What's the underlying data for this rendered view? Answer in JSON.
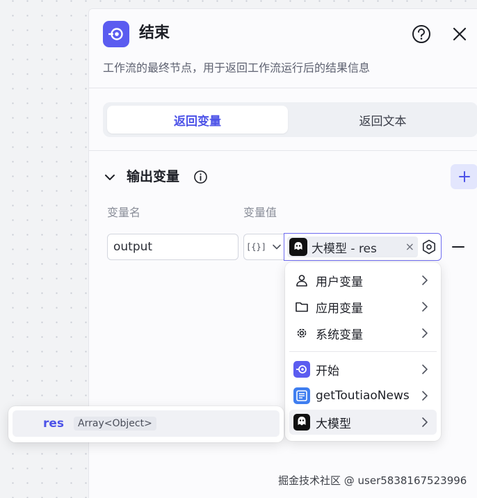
{
  "header": {
    "title": "结束",
    "description": "工作流的最终节点，用于返回工作流运行后的结果信息",
    "accent_color": "#5b5cf0"
  },
  "mode_tabs": [
    {
      "label": "返回变量",
      "active": true
    },
    {
      "label": "返回文本",
      "active": false
    }
  ],
  "output_section": {
    "title": "输出变量",
    "columns": {
      "name": "变量名",
      "value": "变量值"
    },
    "row": {
      "name_value": "output",
      "type_icon": "braces-icon",
      "reference_label": "大模型 - res"
    }
  },
  "dropdown": {
    "items": [
      {
        "label": "用户变量",
        "icon": "user-icon"
      },
      {
        "label": "应用变量",
        "icon": "folder-icon"
      },
      {
        "label": "系统变量",
        "icon": "gear-icon"
      },
      {
        "label": "开始",
        "icon": "start-node-icon"
      },
      {
        "label": "getToutiaoNews",
        "icon": "news-icon"
      },
      {
        "label": "大模型",
        "icon": "llm-icon"
      }
    ],
    "highlighted": "大模型"
  },
  "submenu": {
    "items": [
      {
        "name": "res",
        "type": "Array<Object>"
      }
    ]
  },
  "watermark": "掘金技术社区 @ user5838167523996"
}
